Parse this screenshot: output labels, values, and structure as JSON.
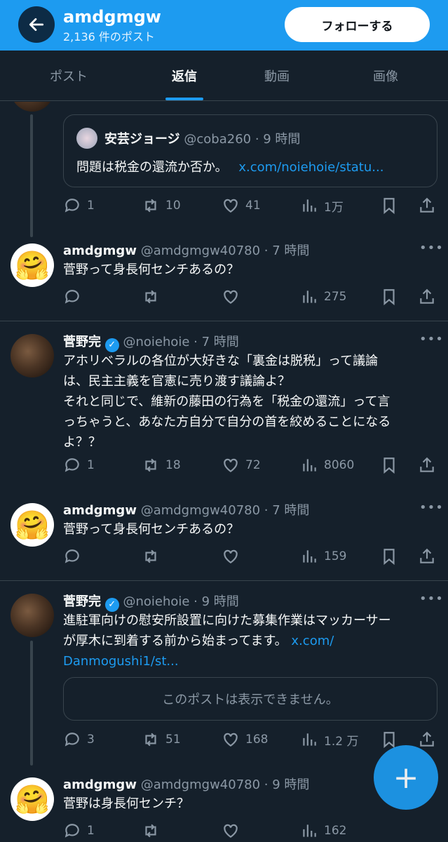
{
  "header": {
    "name": "amdgmgw",
    "post_count": "2,136 件のポスト",
    "follow_label": "フォローする"
  },
  "tabs": [
    {
      "label": "ポスト"
    },
    {
      "label": "返信"
    },
    {
      "label": "動画"
    },
    {
      "label": "画像"
    }
  ],
  "quote": {
    "name": "安芸ジョージ",
    "handle": "@coba260 · 9 時間",
    "text": "問題は税金の還流か否か。",
    "link": "x.com/noiehoie/statu..."
  },
  "stats0": {
    "reply": "1",
    "repost": "10",
    "like": "41",
    "views": "1万"
  },
  "tweets": [
    {
      "name": "amdgmgw",
      "handle": "@amdgmgw40780 · 7 時間",
      "text": "菅野って身長何センチあるの？",
      "reply": "",
      "repost": "",
      "like": "",
      "views": "275"
    },
    {
      "name": "菅野完",
      "handle": "@noiehoie · 7 時間",
      "text_lines": [
        "アホリベラルの各位が大好きな「裏金は脱税」って議論",
        "は、民主主義を官憲に売り渡す議論よ？",
        "それと同じで、維新の藤田の行為を「税金の還流」って言",
        "っちゃうと、あなた方自分で自分の首を絞めることになる",
        "よ？？"
      ],
      "reply": "1",
      "repost": "18",
      "like": "72",
      "views": "8060"
    },
    {
      "name": "amdgmgw",
      "handle": "@amdgmgw40780 · 7 時間",
      "text": "菅野って身長何センチあるの？",
      "reply": "",
      "repost": "",
      "like": "",
      "views": "159"
    },
    {
      "name": "菅野完",
      "handle": "@noiehoie · 9 時間",
      "text_line1": "進駐軍向けの慰安所設置に向けた募集作業はマッカーサー",
      "text_line2": "が厚木に到着する前から始まってます。",
      "link1": "x.com/",
      "link2": "Danmogushi1/st...",
      "quote_unavailable": "このポストは表示できません。",
      "reply": "3",
      "repost": "51",
      "like": "168",
      "views": "1.2 万"
    },
    {
      "name": "amdgmgw",
      "handle": "@amdgmgw40780 · 9 時間",
      "text": "菅野は身長何センチ？",
      "reply": "1",
      "views": "162"
    }
  ],
  "icons": {
    "back": "arrow-left-icon",
    "reply": "speech-bubble-icon",
    "repost": "repost-icon",
    "like": "heart-icon",
    "views": "bar-chart-icon",
    "bookmark": "bookmark-icon",
    "share": "share-icon",
    "verified": "verified-badge-icon",
    "more": "more-dots-icon",
    "compose": "plus-icon"
  },
  "colors": {
    "accent": "#1d9bf0",
    "background": "#15202b",
    "muted": "#8b98a5"
  }
}
